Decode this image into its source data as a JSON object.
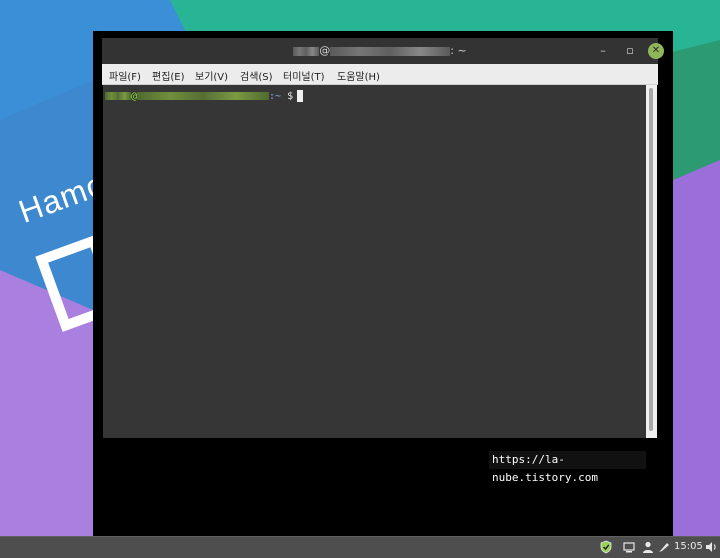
{
  "wallpaper": {
    "text": "Hamo"
  },
  "window": {
    "title_at": "@",
    "title_suffix": ": ~",
    "controls": {
      "minimize": "–",
      "maximize": "▫",
      "close": "✕"
    }
  },
  "menu": {
    "items": [
      {
        "label": "파일(F)"
      },
      {
        "label": "편집(E)"
      },
      {
        "label": "보기(V)"
      },
      {
        "label": "검색(S)"
      },
      {
        "label": "터미널(T)"
      },
      {
        "label": "도움말(H)"
      }
    ]
  },
  "terminal": {
    "prompt_at": "@",
    "prompt_path": ":~",
    "prompt_symbol": "$",
    "watermark": "https://la-nube.tistory.com"
  },
  "taskbar": {
    "clock": "15:05",
    "icons": [
      "shield-icon",
      "network-icon",
      "user-icon",
      "pen-icon",
      "volume-icon"
    ]
  },
  "colors": {
    "terminal_bg": "#363636",
    "prompt_user": "#8ae234",
    "close_button": "#8fb75a",
    "taskbar": "#4e4e4e"
  }
}
